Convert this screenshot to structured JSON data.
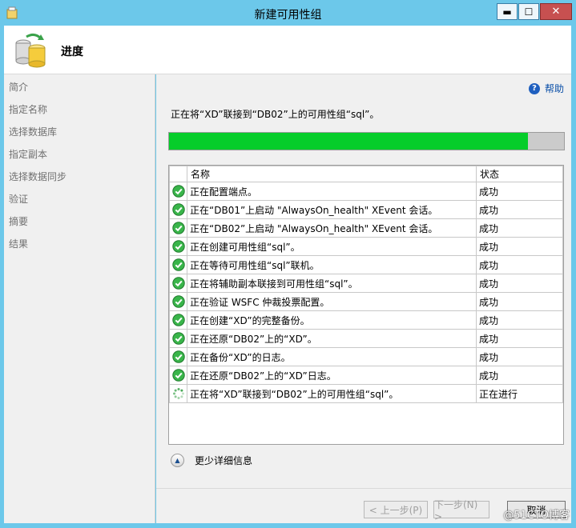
{
  "window": {
    "title": "新建可用性组",
    "min_glyph": "▬",
    "max_glyph": "☐",
    "close_glyph": "✕"
  },
  "header": {
    "title": "进度"
  },
  "nav": {
    "items": [
      "简介",
      "指定名称",
      "选择数据库",
      "指定副本",
      "选择数据同步",
      "验证",
      "摘要",
      "结果"
    ]
  },
  "help": {
    "label": "帮助"
  },
  "status_text": "正在将“XD”联接到“DB02”上的可用性组“sql”。",
  "progress": {
    "fraction": 0.908,
    "color": "#06cd2a"
  },
  "table": {
    "headers": [
      "名称",
      "状态"
    ],
    "rows": [
      {
        "name": "正在配置端点。",
        "state": "成功",
        "status": "success"
      },
      {
        "name": "正在“DB01”上启动 \"AlwaysOn_health\" XEvent 会话。",
        "state": "成功",
        "status": "success"
      },
      {
        "name": "正在“DB02”上启动 \"AlwaysOn_health\" XEvent 会话。",
        "state": "成功",
        "status": "success"
      },
      {
        "name": "正在创建可用性组“sql”。",
        "state": "成功",
        "status": "success"
      },
      {
        "name": "正在等待可用性组“sql”联机。",
        "state": "成功",
        "status": "success"
      },
      {
        "name": "正在将辅助副本联接到可用性组“sql”。",
        "state": "成功",
        "status": "success"
      },
      {
        "name": "正在验证 WSFC 仲裁投票配置。",
        "state": "成功",
        "status": "success"
      },
      {
        "name": "正在创建“XD”的完整备份。",
        "state": "成功",
        "status": "success"
      },
      {
        "name": "正在还原“DB02”上的“XD”。",
        "state": "成功",
        "status": "success"
      },
      {
        "name": "正在备份“XD”的日志。",
        "state": "成功",
        "status": "success"
      },
      {
        "name": "正在还原“DB02”上的“XD”日志。",
        "state": "成功",
        "status": "success"
      },
      {
        "name": "正在将“XD”联接到“DB02”上的可用性组“sql”。",
        "state": "正在进行",
        "status": "in-progress"
      }
    ]
  },
  "details": {
    "label": "更少详细信息"
  },
  "buttons": {
    "prev": "< 上一步(P)",
    "next": "下一步(N) >",
    "cancel": "取消"
  },
  "watermark": "@51CTO博客",
  "colors": {
    "titlebar": "#6cc8ea",
    "success": "#2aa63a",
    "link": "#0a4fa8"
  },
  "icons": {
    "app": "app-icon",
    "header": "database-sync-icon",
    "help": "help-icon",
    "success": "check-circle-icon",
    "in_progress": "spinner-icon",
    "details": "collapse-up-icon"
  }
}
